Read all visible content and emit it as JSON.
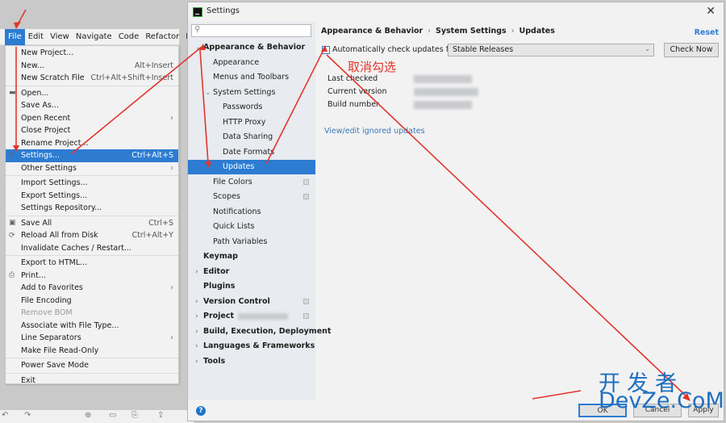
{
  "ide": {
    "menubar": [
      "File",
      "Edit",
      "View",
      "Navigate",
      "Code",
      "Refactor",
      "R"
    ],
    "active_menu": "File"
  },
  "file_menu": {
    "items": [
      {
        "label": "New Project...",
        "shortcut": "",
        "submenu": false
      },
      {
        "label": "New...",
        "shortcut": "Alt+Insert",
        "submenu": false
      },
      {
        "label": "New Scratch File",
        "shortcut": "Ctrl+Alt+Shift+Insert",
        "submenu": false
      },
      {
        "label": "Open...",
        "shortcut": "",
        "submenu": false,
        "icon": "folder-icon"
      },
      {
        "label": "Save As...",
        "shortcut": "",
        "submenu": false
      },
      {
        "label": "Open Recent",
        "shortcut": "",
        "submenu": true
      },
      {
        "label": "Close Project",
        "shortcut": "",
        "submenu": false
      },
      {
        "label": "Rename Project...",
        "shortcut": "",
        "submenu": false
      },
      {
        "label": "Settings...",
        "shortcut": "Ctrl+Alt+S",
        "submenu": false,
        "selected": true,
        "icon": "wrench-icon"
      },
      {
        "label": "Other Settings",
        "shortcut": "",
        "submenu": true
      },
      {
        "label": "Import Settings...",
        "shortcut": "",
        "submenu": false
      },
      {
        "label": "Export Settings...",
        "shortcut": "",
        "submenu": false
      },
      {
        "label": "Settings Repository...",
        "shortcut": "",
        "submenu": false
      },
      {
        "label": "Save All",
        "shortcut": "Ctrl+S",
        "submenu": false,
        "icon": "save-icon"
      },
      {
        "label": "Reload All from Disk",
        "shortcut": "Ctrl+Alt+Y",
        "submenu": false,
        "icon": "reload-icon"
      },
      {
        "label": "Invalidate Caches / Restart...",
        "shortcut": "",
        "submenu": false
      },
      {
        "label": "Export to HTML...",
        "shortcut": "",
        "submenu": false
      },
      {
        "label": "Print...",
        "shortcut": "",
        "submenu": false,
        "icon": "print-icon"
      },
      {
        "label": "Add to Favorites",
        "shortcut": "",
        "submenu": true
      },
      {
        "label": "File Encoding",
        "shortcut": "",
        "submenu": false
      },
      {
        "label": "Remove BOM",
        "shortcut": "",
        "submenu": false,
        "disabled": true
      },
      {
        "label": "Associate with File Type...",
        "shortcut": "",
        "submenu": false
      },
      {
        "label": "Line Separators",
        "shortcut": "",
        "submenu": true
      },
      {
        "label": "Make File Read-Only",
        "shortcut": "",
        "submenu": false
      },
      {
        "label": "Power Save Mode",
        "shortcut": "",
        "submenu": false
      },
      {
        "label": "Exit",
        "shortcut": "",
        "submenu": false
      }
    ]
  },
  "dialog": {
    "title": "Settings",
    "close_glyph": "✕",
    "search_placeholder": "",
    "tree": [
      {
        "label": "Appearance & Behavior",
        "bold": true,
        "expanded": true,
        "level": 0
      },
      {
        "label": "Appearance",
        "level": 1
      },
      {
        "label": "Menus and Toolbars",
        "level": 1
      },
      {
        "label": "System Settings",
        "level": 1,
        "expanded": true
      },
      {
        "label": "Passwords",
        "level": 2
      },
      {
        "label": "HTTP Proxy",
        "level": 2
      },
      {
        "label": "Data Sharing",
        "level": 2
      },
      {
        "label": "Date Formats",
        "level": 2
      },
      {
        "label": "Updates",
        "level": 2,
        "selected": true
      },
      {
        "label": "File Colors",
        "level": 1,
        "project_icon": true
      },
      {
        "label": "Scopes",
        "level": 1,
        "project_icon": true
      },
      {
        "label": "Notifications",
        "level": 1
      },
      {
        "label": "Quick Lists",
        "level": 1
      },
      {
        "label": "Path Variables",
        "level": 1
      },
      {
        "label": "Keymap",
        "bold": true,
        "level": 0
      },
      {
        "label": "Editor",
        "bold": true,
        "level": 0,
        "collapsed": true
      },
      {
        "label": "Plugins",
        "bold": true,
        "level": 0
      },
      {
        "label": "Version Control",
        "bold": true,
        "level": 0,
        "collapsed": true,
        "project_icon": true
      },
      {
        "label": "Project",
        "bold": true,
        "level": 0,
        "collapsed": true,
        "project_icon": true
      },
      {
        "label": "Build, Execution, Deployment",
        "bold": true,
        "level": 0,
        "collapsed": true
      },
      {
        "label": "Languages & Frameworks",
        "bold": true,
        "level": 0,
        "collapsed": true
      },
      {
        "label": "Tools",
        "bold": true,
        "level": 0,
        "collapsed": true
      }
    ],
    "content": {
      "breadcrumb": [
        "Appearance & Behavior",
        "System Settings",
        "Updates"
      ],
      "reset_label": "Reset",
      "auto_check_label": "Automatically check updates for",
      "auto_check_checked": false,
      "channel_value": "Stable Releases",
      "check_now_label": "Check Now",
      "annotation": "取消勾选",
      "info_labels": [
        "Last checked",
        "Current version",
        "Build number"
      ],
      "ignored_link": "View/edit ignored updates"
    },
    "footer": {
      "help": "?",
      "ok_label": "OK",
      "cancel_label": "Cancel",
      "apply_label": "Apply"
    }
  },
  "watermark": {
    "line1": "开发者",
    "line2": "DevZe.CoM"
  }
}
